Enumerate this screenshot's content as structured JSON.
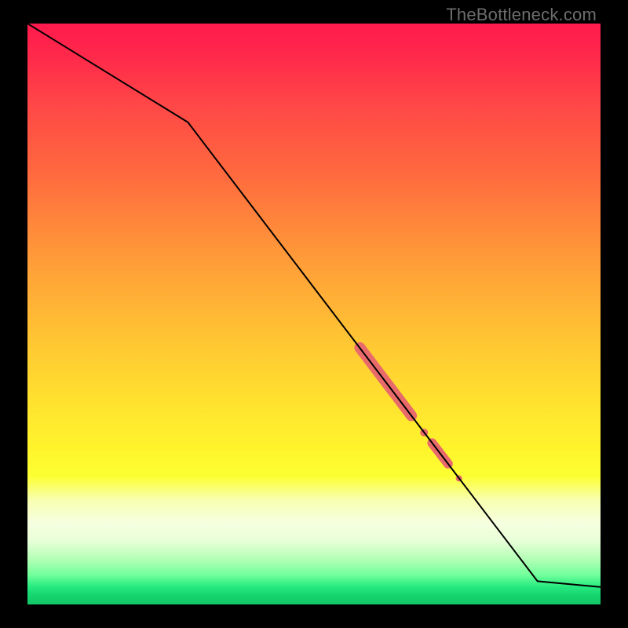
{
  "watermark": "TheBottleneck.com",
  "chart_data": {
    "type": "line",
    "title": "",
    "xlabel": "",
    "ylabel": "",
    "xlim": [
      0,
      100
    ],
    "ylim": [
      0,
      100
    ],
    "legend": false,
    "grid": false,
    "series": [
      {
        "name": "curve",
        "x": [
          0,
          28,
          89,
          100
        ],
        "y": [
          100,
          83,
          4,
          3
        ],
        "stroke": "#000000",
        "width": 2
      }
    ],
    "markers": [
      {
        "name": "seg-long",
        "x_start": 58,
        "y_start": 44.2,
        "x_end": 67,
        "y_end": 32.5,
        "stroke": "#e86a6a",
        "width": 14,
        "cap": "round"
      },
      {
        "name": "dot-mid-1",
        "cx": 69.2,
        "cy": 29.6,
        "r": 5,
        "fill": "#e86a6a"
      },
      {
        "name": "seg-short",
        "x_start": 70.6,
        "y_start": 27.8,
        "x_end": 73.4,
        "y_end": 24.2,
        "stroke": "#e86a6a",
        "width": 12,
        "cap": "round"
      },
      {
        "name": "dot-mid-2",
        "cx": 75.3,
        "cy": 21.7,
        "r": 4,
        "fill": "#e86a6a"
      }
    ],
    "gradient_stops": [
      {
        "pos": 0,
        "color": "#ff1a4d"
      },
      {
        "pos": 0.06,
        "color": "#ff2a4a"
      },
      {
        "pos": 0.14,
        "color": "#ff4747"
      },
      {
        "pos": 0.26,
        "color": "#ff6a3e"
      },
      {
        "pos": 0.42,
        "color": "#ffa038"
      },
      {
        "pos": 0.55,
        "color": "#ffc733"
      },
      {
        "pos": 0.66,
        "color": "#ffe42e"
      },
      {
        "pos": 0.74,
        "color": "#fff62c"
      },
      {
        "pos": 0.78,
        "color": "#fcff33"
      },
      {
        "pos": 0.82,
        "color": "#f8ffb0"
      },
      {
        "pos": 0.86,
        "color": "#f6ffe0"
      },
      {
        "pos": 0.89,
        "color": "#e8ffd8"
      },
      {
        "pos": 0.92,
        "color": "#b8ffb8"
      },
      {
        "pos": 0.95,
        "color": "#6fff9a"
      },
      {
        "pos": 0.97,
        "color": "#25e97e"
      },
      {
        "pos": 0.985,
        "color": "#15d46e"
      },
      {
        "pos": 1.0,
        "color": "#12c766"
      }
    ]
  }
}
